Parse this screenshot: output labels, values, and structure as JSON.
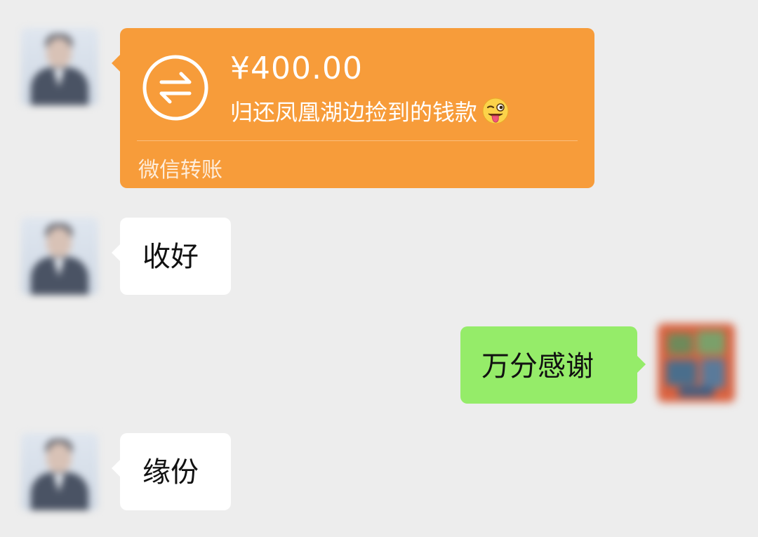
{
  "messages": [
    {
      "type": "transfer",
      "sender": "other",
      "amount": "¥400.00",
      "note": "归还凤凰湖边捡到的钱款",
      "label": "微信转账",
      "icon": "transfer-arrows-icon",
      "emoji": "winking-face-with-tongue-icon"
    },
    {
      "type": "text",
      "sender": "other",
      "text": "收好"
    },
    {
      "type": "text",
      "sender": "self",
      "text": "万分感谢"
    },
    {
      "type": "text",
      "sender": "other",
      "text": "缘份"
    }
  ],
  "colors": {
    "background": "#ededed",
    "transfer_bubble": "#f79c3a",
    "incoming_bubble": "#ffffff",
    "outgoing_bubble": "#95ec69"
  }
}
